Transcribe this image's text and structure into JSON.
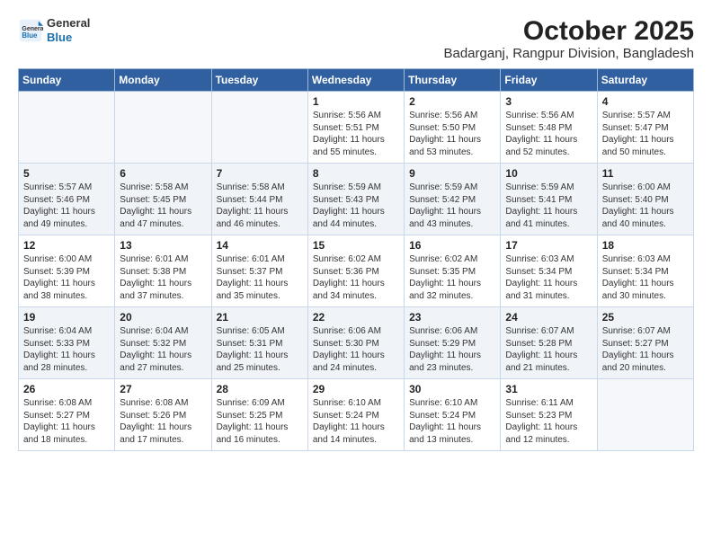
{
  "header": {
    "logo_general": "General",
    "logo_blue": "Blue",
    "title": "October 2025",
    "subtitle": "Badarganj, Rangpur Division, Bangladesh"
  },
  "days_of_week": [
    "Sunday",
    "Monday",
    "Tuesday",
    "Wednesday",
    "Thursday",
    "Friday",
    "Saturday"
  ],
  "weeks": [
    [
      {
        "day": "",
        "info": ""
      },
      {
        "day": "",
        "info": ""
      },
      {
        "day": "",
        "info": ""
      },
      {
        "day": "1",
        "info": "Sunrise: 5:56 AM\nSunset: 5:51 PM\nDaylight: 11 hours\nand 55 minutes."
      },
      {
        "day": "2",
        "info": "Sunrise: 5:56 AM\nSunset: 5:50 PM\nDaylight: 11 hours\nand 53 minutes."
      },
      {
        "day": "3",
        "info": "Sunrise: 5:56 AM\nSunset: 5:48 PM\nDaylight: 11 hours\nand 52 minutes."
      },
      {
        "day": "4",
        "info": "Sunrise: 5:57 AM\nSunset: 5:47 PM\nDaylight: 11 hours\nand 50 minutes."
      }
    ],
    [
      {
        "day": "5",
        "info": "Sunrise: 5:57 AM\nSunset: 5:46 PM\nDaylight: 11 hours\nand 49 minutes."
      },
      {
        "day": "6",
        "info": "Sunrise: 5:58 AM\nSunset: 5:45 PM\nDaylight: 11 hours\nand 47 minutes."
      },
      {
        "day": "7",
        "info": "Sunrise: 5:58 AM\nSunset: 5:44 PM\nDaylight: 11 hours\nand 46 minutes."
      },
      {
        "day": "8",
        "info": "Sunrise: 5:59 AM\nSunset: 5:43 PM\nDaylight: 11 hours\nand 44 minutes."
      },
      {
        "day": "9",
        "info": "Sunrise: 5:59 AM\nSunset: 5:42 PM\nDaylight: 11 hours\nand 43 minutes."
      },
      {
        "day": "10",
        "info": "Sunrise: 5:59 AM\nSunset: 5:41 PM\nDaylight: 11 hours\nand 41 minutes."
      },
      {
        "day": "11",
        "info": "Sunrise: 6:00 AM\nSunset: 5:40 PM\nDaylight: 11 hours\nand 40 minutes."
      }
    ],
    [
      {
        "day": "12",
        "info": "Sunrise: 6:00 AM\nSunset: 5:39 PM\nDaylight: 11 hours\nand 38 minutes."
      },
      {
        "day": "13",
        "info": "Sunrise: 6:01 AM\nSunset: 5:38 PM\nDaylight: 11 hours\nand 37 minutes."
      },
      {
        "day": "14",
        "info": "Sunrise: 6:01 AM\nSunset: 5:37 PM\nDaylight: 11 hours\nand 35 minutes."
      },
      {
        "day": "15",
        "info": "Sunrise: 6:02 AM\nSunset: 5:36 PM\nDaylight: 11 hours\nand 34 minutes."
      },
      {
        "day": "16",
        "info": "Sunrise: 6:02 AM\nSunset: 5:35 PM\nDaylight: 11 hours\nand 32 minutes."
      },
      {
        "day": "17",
        "info": "Sunrise: 6:03 AM\nSunset: 5:34 PM\nDaylight: 11 hours\nand 31 minutes."
      },
      {
        "day": "18",
        "info": "Sunrise: 6:03 AM\nSunset: 5:34 PM\nDaylight: 11 hours\nand 30 minutes."
      }
    ],
    [
      {
        "day": "19",
        "info": "Sunrise: 6:04 AM\nSunset: 5:33 PM\nDaylight: 11 hours\nand 28 minutes."
      },
      {
        "day": "20",
        "info": "Sunrise: 6:04 AM\nSunset: 5:32 PM\nDaylight: 11 hours\nand 27 minutes."
      },
      {
        "day": "21",
        "info": "Sunrise: 6:05 AM\nSunset: 5:31 PM\nDaylight: 11 hours\nand 25 minutes."
      },
      {
        "day": "22",
        "info": "Sunrise: 6:06 AM\nSunset: 5:30 PM\nDaylight: 11 hours\nand 24 minutes."
      },
      {
        "day": "23",
        "info": "Sunrise: 6:06 AM\nSunset: 5:29 PM\nDaylight: 11 hours\nand 23 minutes."
      },
      {
        "day": "24",
        "info": "Sunrise: 6:07 AM\nSunset: 5:28 PM\nDaylight: 11 hours\nand 21 minutes."
      },
      {
        "day": "25",
        "info": "Sunrise: 6:07 AM\nSunset: 5:27 PM\nDaylight: 11 hours\nand 20 minutes."
      }
    ],
    [
      {
        "day": "26",
        "info": "Sunrise: 6:08 AM\nSunset: 5:27 PM\nDaylight: 11 hours\nand 18 minutes."
      },
      {
        "day": "27",
        "info": "Sunrise: 6:08 AM\nSunset: 5:26 PM\nDaylight: 11 hours\nand 17 minutes."
      },
      {
        "day": "28",
        "info": "Sunrise: 6:09 AM\nSunset: 5:25 PM\nDaylight: 11 hours\nand 16 minutes."
      },
      {
        "day": "29",
        "info": "Sunrise: 6:10 AM\nSunset: 5:24 PM\nDaylight: 11 hours\nand 14 minutes."
      },
      {
        "day": "30",
        "info": "Sunrise: 6:10 AM\nSunset: 5:24 PM\nDaylight: 11 hours\nand 13 minutes."
      },
      {
        "day": "31",
        "info": "Sunrise: 6:11 AM\nSunset: 5:23 PM\nDaylight: 11 hours\nand 12 minutes."
      },
      {
        "day": "",
        "info": ""
      }
    ]
  ]
}
